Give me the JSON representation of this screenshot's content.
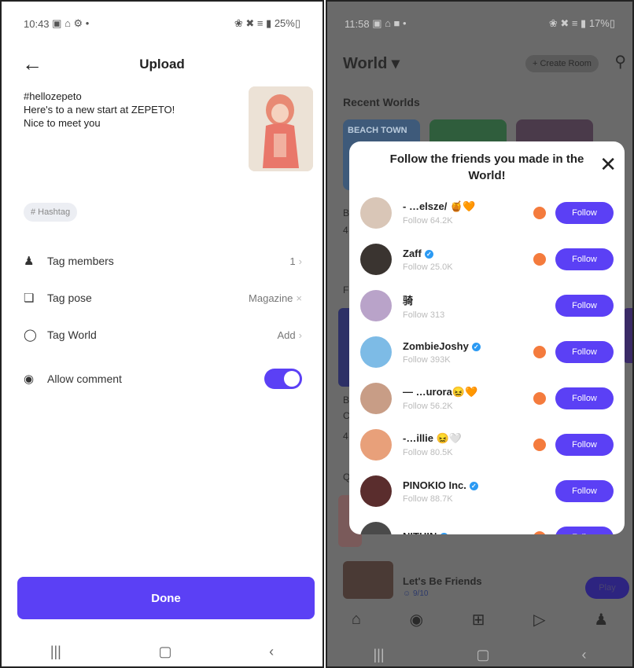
{
  "left": {
    "status_time": "10:43",
    "status_icons": "▣ ⌂ ⚙ •",
    "status_right": "❀ ✖ ≡ ▮ 25%▯",
    "back_icon": "arrow-left-icon",
    "title": "Upload",
    "caption_lines": [
      "#hellozepeto",
      "Here's to a new start at ZEPETO!",
      "Nice to meet you"
    ],
    "hashtag_chip": "Hashtag",
    "rows": [
      {
        "label": "Tag members",
        "value": "1"
      },
      {
        "label": "Tag pose",
        "value": "Magazine"
      },
      {
        "label": "Tag World",
        "value": "Add"
      },
      {
        "label": "Allow comment",
        "value": ""
      }
    ],
    "allow_comment_on": true,
    "done_label": "Done"
  },
  "right": {
    "status_time": "11:58",
    "status_icons": "▣ ⌂ ■ •",
    "status_right": "❀ ✖ ≡ ▮ 17%▯",
    "world_label": "World ▾",
    "create_room": "+ Create Room",
    "recent_worlds": "Recent Worlds",
    "recent_card_text": "BEACH TOWN",
    "bottom_room_name": "Let's Be Friends",
    "bottom_room_count": "☺ 9/10",
    "play_label": "Play",
    "modal": {
      "title": "Follow the friends you made in the World!",
      "close_icon": "close-icon",
      "friends": [
        {
          "name": "- …elsze/ 🍯🧡",
          "followers": "Follow 64.2K",
          "verified": false,
          "dot": true,
          "color": "#d9c6b7"
        },
        {
          "name": "Zaff",
          "followers": "Follow 25.0K",
          "verified": true,
          "dot": true,
          "color": "#3a3430"
        },
        {
          "name": "骑",
          "followers": "Follow 313",
          "verified": false,
          "dot": false,
          "color": "#b9a3c9"
        },
        {
          "name": "ZombieJoshy",
          "followers": "Follow 393K",
          "verified": true,
          "dot": true,
          "color": "#7dbbe6"
        },
        {
          "name": "— …urora😖🧡",
          "followers": "Follow 56.2K",
          "verified": false,
          "dot": true,
          "color": "#c89d86"
        },
        {
          "name": "-…illie 😖🤍",
          "followers": "Follow 80.5K",
          "verified": false,
          "dot": true,
          "color": "#e8a07a"
        },
        {
          "name": "PINOKIO Inc.",
          "followers": "Follow 88.7K",
          "verified": true,
          "dot": false,
          "color": "#5a2d2d"
        },
        {
          "name": "NITHIN",
          "followers": "",
          "verified": true,
          "dot": true,
          "color": "#4a4a4a"
        }
      ],
      "follow_label": "Follow"
    },
    "side_texts": [
      "B",
      "4",
      "F",
      "B",
      "C",
      "4",
      "Q"
    ]
  }
}
